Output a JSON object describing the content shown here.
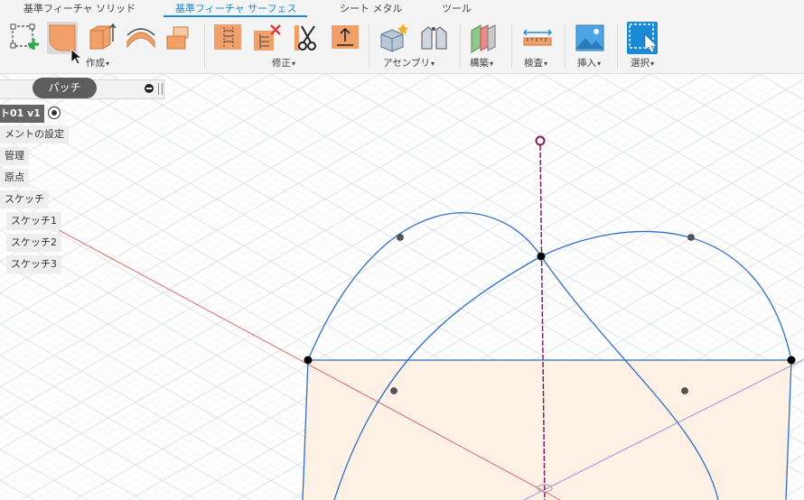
{
  "tabs": [
    {
      "label": "基準フィーチャ ソリッド",
      "active": false
    },
    {
      "label": "基準フィーチャ サーフェス",
      "active": true
    },
    {
      "label": "シート メタル",
      "active": false
    },
    {
      "label": "ツール",
      "active": false
    }
  ],
  "groups": {
    "create": "作成",
    "modify": "修正",
    "assemble": "アセンブリ",
    "construct": "構築",
    "inspect": "検査",
    "insert": "挿入",
    "select": "選択"
  },
  "tools": {
    "create": [
      "create-sketch-icon",
      "patch-icon",
      "extrude-icon",
      "revolve-icon",
      "loft-icon"
    ],
    "modify": [
      "offset-surface-icon",
      "delete-icon",
      "trim-icon",
      "thicken-icon"
    ],
    "assemble": [
      "new-component-icon",
      "joint-icon"
    ],
    "construct": [
      "offset-plane-icon"
    ],
    "inspect": [
      "measure-icon"
    ],
    "insert": [
      "insert-image-icon"
    ],
    "select": [
      "select-icon"
    ]
  },
  "tooltip": {
    "text": "パッチ"
  },
  "browser": {
    "root": "ト01 v1",
    "items": [
      "メントの設定",
      "管理",
      "原点",
      "スケッチ"
    ],
    "sketches": [
      "スケッチ1",
      "スケッチ2",
      "スケッチ3"
    ]
  },
  "colors": {
    "accent": "#1b8ad6",
    "curve": "#2f6fc4",
    "axis_z": "#7a1552",
    "axis_x": "#e05a5a",
    "axis_y": "#9b84d9",
    "patch_fill": "#fdf1e6",
    "tool_orange": "#f2a06a"
  }
}
